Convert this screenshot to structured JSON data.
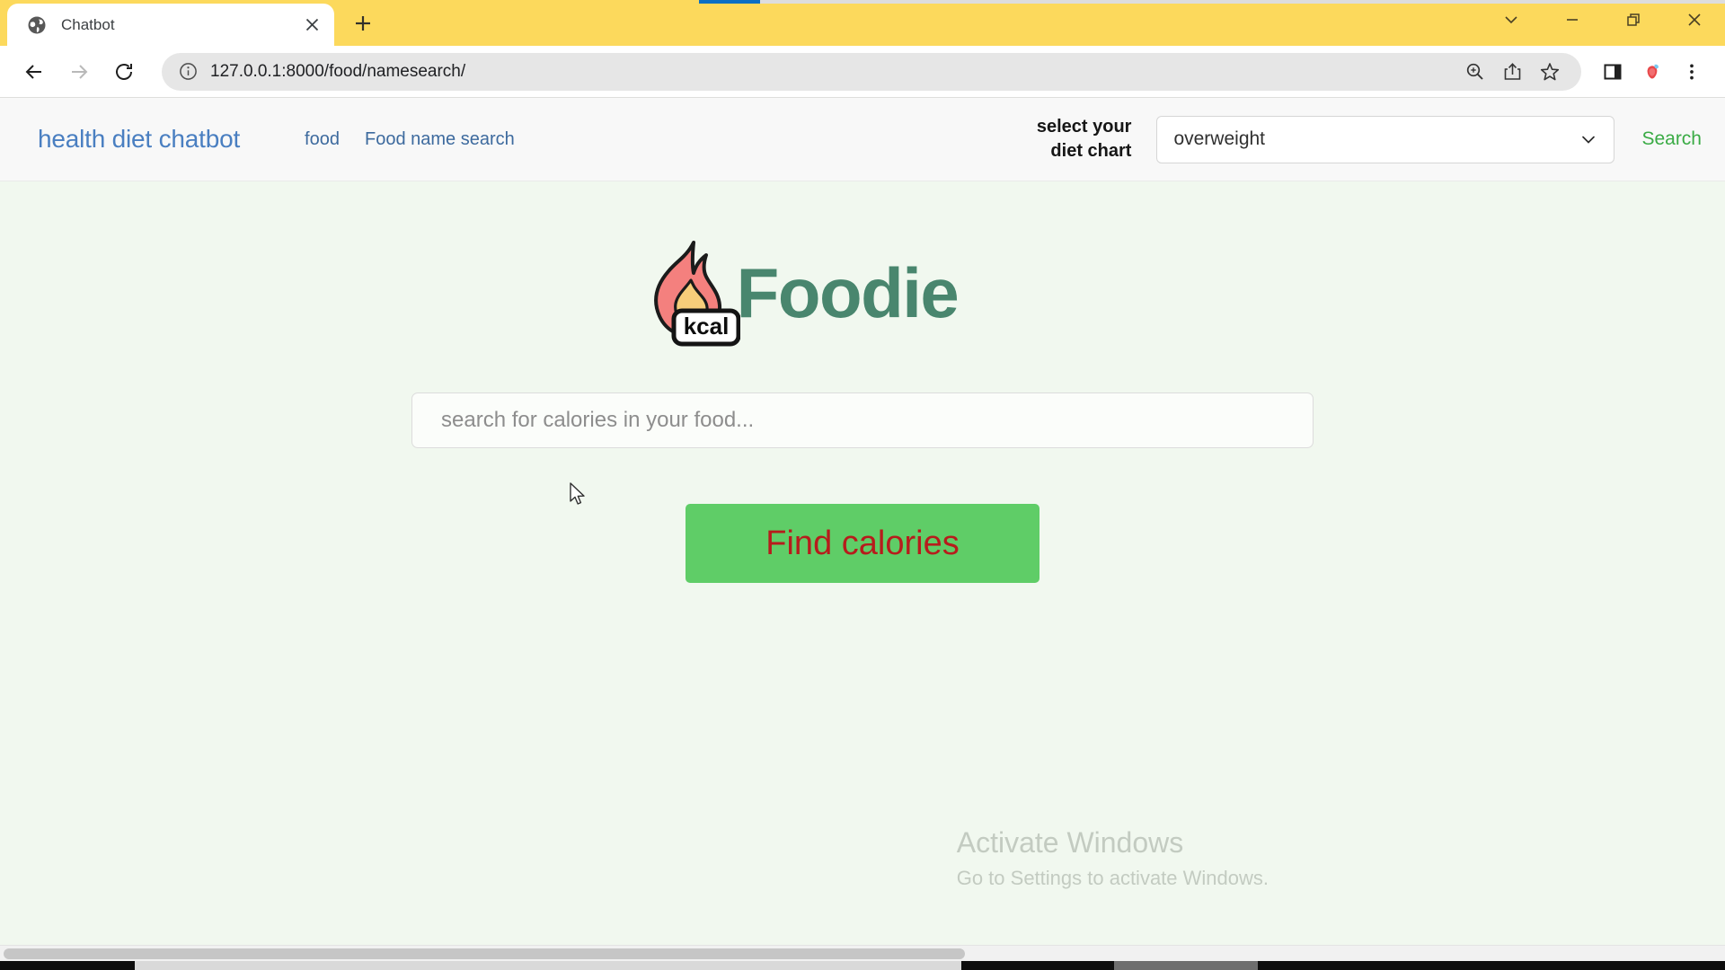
{
  "browser": {
    "tab": {
      "title": "Chatbot",
      "favicon": "globe-icon",
      "close": "×"
    },
    "new_tab_label": "+",
    "window_controls": {
      "expand": "chevron-down-icon",
      "minimize": "minimize-icon",
      "restore": "restore-icon",
      "close": "close-icon"
    },
    "toolbar": {
      "back": "back-arrow-icon",
      "forward": "forward-arrow-icon",
      "reload": "reload-icon",
      "site_info": "info-icon",
      "url": "127.0.0.1:8000/food/namesearch/",
      "zoom": "zoom-in-icon",
      "share": "share-icon",
      "bookmark": "star-icon",
      "side_panel": "side-panel-icon",
      "extension": "extension-icon",
      "menu": "three-dot-menu-icon"
    }
  },
  "site": {
    "brand": "health diet chatbot",
    "nav_links": [
      {
        "label": "food"
      },
      {
        "label": "Food name search"
      }
    ],
    "diet_chart": {
      "label_line1": "select your",
      "label_line2": "diet chart",
      "selected": "overweight",
      "options": [
        "overweight"
      ],
      "chevron": "chevron-down-icon"
    },
    "search_link": "Search"
  },
  "hero": {
    "logo": {
      "icon": "flame-kcal-icon",
      "badge_text": "kcal",
      "word": "Foodie"
    },
    "search": {
      "value": "",
      "placeholder": "search for calories in your food..."
    },
    "find_button": "Find calories"
  },
  "watermark": {
    "title": "Activate Windows",
    "subtitle": "Go to Settings to activate Windows."
  },
  "colors": {
    "titlebar": "#fcd95c",
    "page_background": "#f1f8ef",
    "nav_background": "#f8f8f8",
    "brand": "#4a7fc1",
    "nav_link": "#3d6a9e",
    "search_link_green": "#3aab45",
    "button_green": "#5fcd67",
    "button_text_red": "#b71c1c",
    "logo_green": "#49866e",
    "flame_pink": "#f4807e",
    "flame_yellow": "#f7cd7a"
  }
}
